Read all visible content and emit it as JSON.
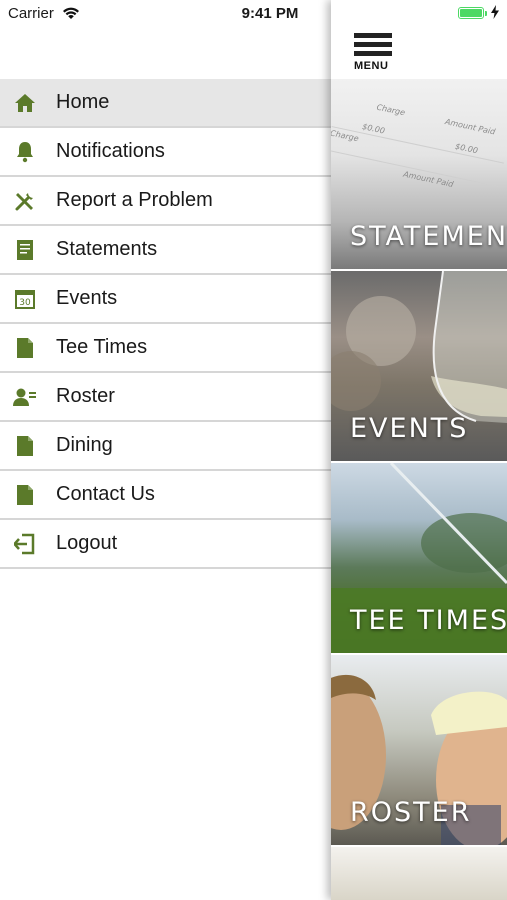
{
  "status_bar": {
    "carrier": "Carrier",
    "time": "9:41 PM",
    "battery_level": 1.0
  },
  "colors": {
    "icon_green": "#5b7a2a",
    "active_row": "#e6e6e6",
    "divider": "#d6d6d6",
    "battery_green": "#4cd964"
  },
  "menu": {
    "items": [
      {
        "label": "Home",
        "icon": "home-icon",
        "active": true
      },
      {
        "label": "Notifications",
        "icon": "bell-icon"
      },
      {
        "label": "Report a Problem",
        "icon": "tools-icon"
      },
      {
        "label": "Statements",
        "icon": "statement-icon"
      },
      {
        "label": "Events",
        "icon": "calendar-icon"
      },
      {
        "label": "Tee Times",
        "icon": "document-icon"
      },
      {
        "label": "Roster",
        "icon": "roster-icon"
      },
      {
        "label": "Dining",
        "icon": "document-icon"
      },
      {
        "label": "Contact Us",
        "icon": "document-icon"
      },
      {
        "label": "Logout",
        "icon": "logout-icon"
      }
    ]
  },
  "right_panel": {
    "menu_button_label": "MENU",
    "tiles": [
      {
        "label": "STATEMENTS"
      },
      {
        "label": "EVENTS"
      },
      {
        "label": "TEE TIMES"
      },
      {
        "label": "ROSTER"
      }
    ]
  }
}
